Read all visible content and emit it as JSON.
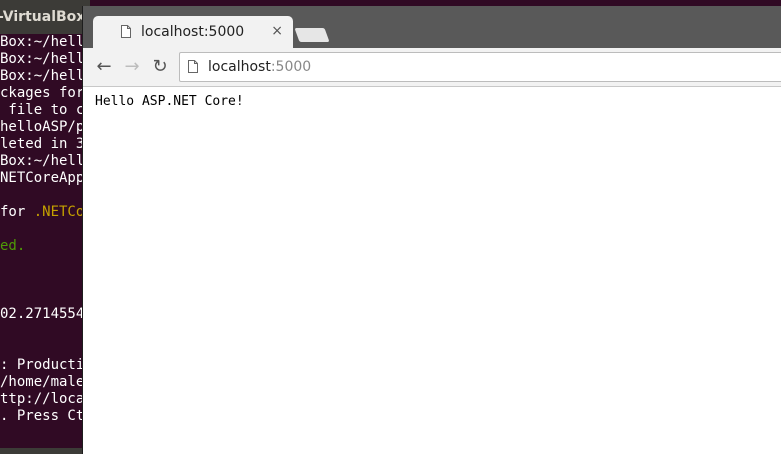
{
  "terminal": {
    "title": "-VirtualBox",
    "lines": [
      {
        "text": "Box:~/hell",
        "color": "white"
      },
      {
        "text": "Box:~/hell",
        "color": "white"
      },
      {
        "text": "Box:~/hell",
        "color": "white"
      },
      {
        "text": "ckages for",
        "color": "white"
      },
      {
        "text": " file to c",
        "color": "white"
      },
      {
        "text": "helloASP/p",
        "color": "white"
      },
      {
        "text": "leted in 3",
        "color": "white"
      },
      {
        "text": "Box:~/hell",
        "color": "white"
      },
      {
        "text": "NETCoreApp",
        "color": "white"
      },
      {
        "text": "",
        "color": "white"
      },
      {
        "text": "for .NETCo",
        "color": "mixed"
      },
      {
        "text": "",
        "color": "white"
      },
      {
        "text": "ed.",
        "color": "green"
      },
      {
        "text": "",
        "color": "white"
      },
      {
        "text": "",
        "color": "white"
      },
      {
        "text": "",
        "color": "white"
      },
      {
        "text": "02.2714554",
        "color": "white"
      },
      {
        "text": "",
        "color": "white"
      },
      {
        "text": "",
        "color": "white"
      },
      {
        "text": ": Producti",
        "color": "white"
      },
      {
        "text": "/home/male",
        "color": "white"
      },
      {
        "text": "ttp://loca",
        "color": "white"
      },
      {
        "text": ". Press Ct",
        "color": "white"
      }
    ]
  },
  "browser": {
    "tab": {
      "title": "localhost:5000",
      "close_glyph": "×"
    },
    "toolbar": {
      "back_glyph": "←",
      "forward_glyph": "→",
      "reload_glyph": "↻",
      "url_host": "localhost",
      "url_port": ":5000"
    },
    "page": {
      "body_text": "Hello ASP.NET Core!"
    }
  }
}
